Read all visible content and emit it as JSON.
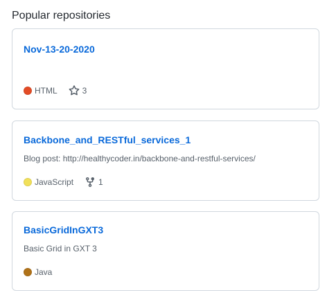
{
  "section": {
    "title": "Popular repositories"
  },
  "repos": [
    {
      "name": "Nov-13-20-2020",
      "description": "",
      "language": "HTML",
      "language_color": "#e34c26",
      "stat_type": "stars",
      "stat_icon": "star-icon",
      "stat_value": "3"
    },
    {
      "name": "Backbone_and_RESTful_services_1",
      "description": "Blog post: http://healthycoder.in/backbone-and-restful-services/",
      "language": "JavaScript",
      "language_color": "#f1e05a",
      "stat_type": "forks",
      "stat_icon": "fork-icon",
      "stat_value": "1"
    },
    {
      "name": "BasicGridInGXT3",
      "description": "Basic Grid in GXT 3",
      "language": "Java",
      "language_color": "#b07219"
    }
  ],
  "colors": {
    "link": "#0969da",
    "border": "#d0d7de",
    "muted_text": "#57606a"
  }
}
